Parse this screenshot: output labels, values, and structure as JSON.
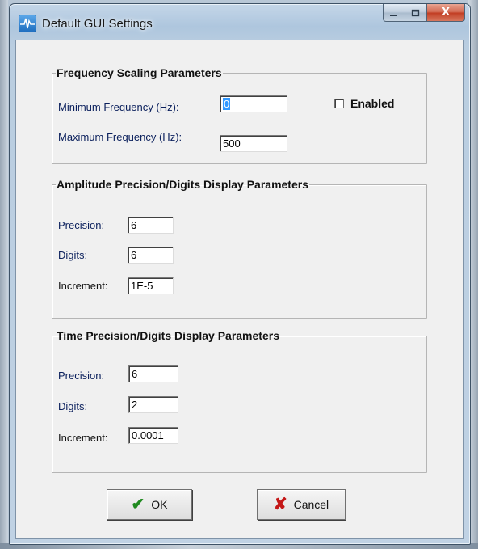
{
  "window": {
    "title": "Default GUI Settings",
    "controls": {
      "minimize": "—",
      "maximize": "▫",
      "close": "X"
    }
  },
  "frequency": {
    "title": "Frequency Scaling Parameters",
    "min_label": "Minimum  Frequency (Hz):",
    "min_value": "0",
    "max_label": "Maximum Frequency (Hz):",
    "max_value": "500",
    "enabled_label": "Enabled",
    "enabled_checked": false
  },
  "amplitude": {
    "title": "Amplitude Precision/Digits Display Parameters",
    "precision_label": "Precision:",
    "precision_value": "6",
    "digits_label": "Digits:",
    "digits_value": "6",
    "increment_label": "Increment:",
    "increment_value": "1E-5"
  },
  "time": {
    "title": "Time Precision/Digits Display Parameters",
    "precision_label": "Precision:",
    "precision_value": "6",
    "digits_label": "Digits:",
    "digits_value": "2",
    "increment_label": "Increment:",
    "increment_value": "0.0001"
  },
  "buttons": {
    "ok_label": "OK",
    "ok_icon": "checkmark-icon",
    "cancel_label": "Cancel",
    "cancel_icon": "x-cross-icon"
  },
  "colors": {
    "label_blue": "#0a1f5c",
    "ok_green": "#1f8a1f",
    "cancel_red": "#c41717",
    "selection": "#3399ff"
  }
}
